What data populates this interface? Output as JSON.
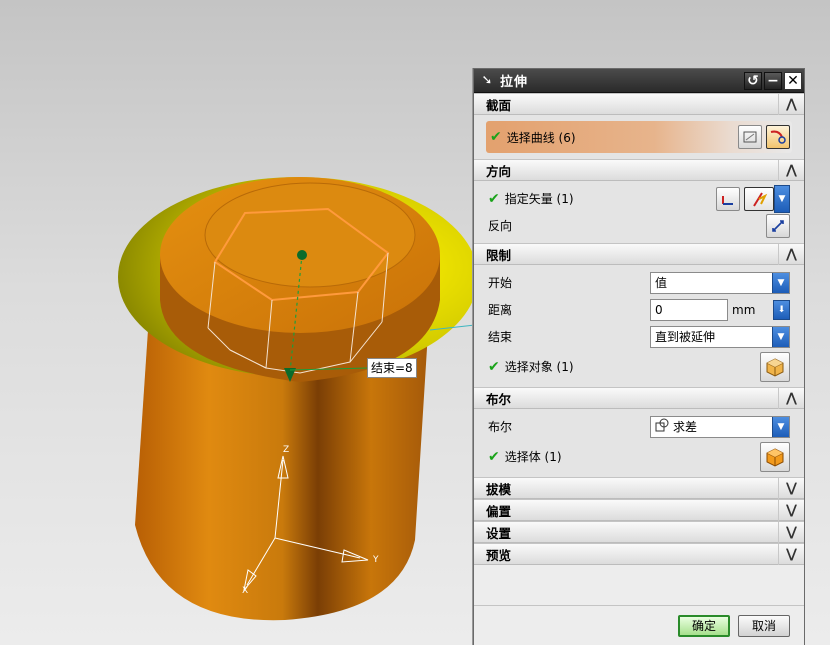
{
  "viewport": {
    "callout_text": "结束=8",
    "axis_labels": {
      "z": "Z",
      "y": "Y",
      "x": "X"
    },
    "colors": {
      "body": "#d9820c",
      "flange": "#c9c200",
      "preview": "#ff9a3c"
    }
  },
  "dialog": {
    "title": "拉伸",
    "title_icon": "pin-icon",
    "title_buttons": {
      "reset": "↺",
      "minimize": "−",
      "close": "✕"
    },
    "sections": {
      "section": {
        "header": "截面",
        "select_curve": "选择曲线 (6)"
      },
      "direction": {
        "header": "方向",
        "specify_vector": "指定矢量 (1)",
        "reverse": "反向"
      },
      "limits": {
        "header": "限制",
        "start_label": "开始",
        "start_value": "值",
        "distance_label": "距离",
        "distance_value": "0",
        "distance_unit": "mm",
        "end_label": "结束",
        "end_value": "直到被延伸",
        "select_object": "选择对象 (1)"
      },
      "boolean": {
        "header": "布尔",
        "boolean_label": "布尔",
        "boolean_value": "求差",
        "select_body": "选择体 (1)"
      },
      "draft": {
        "header": "拔模"
      },
      "offset": {
        "header": "偏置"
      },
      "settings": {
        "header": "设置"
      },
      "preview": {
        "header": "预览"
      }
    },
    "buttons": {
      "ok": "确定",
      "cancel": "取消"
    }
  }
}
